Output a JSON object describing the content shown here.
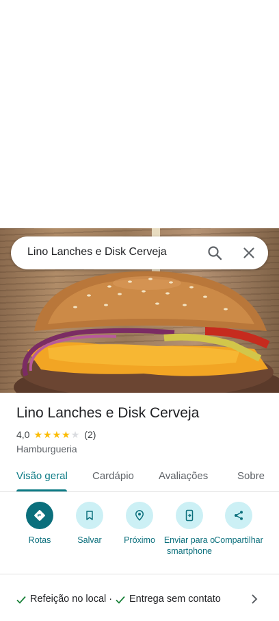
{
  "search": {
    "query": "Lino Lanches e Disk Cerveja"
  },
  "place": {
    "name": "Lino Lanches e Disk Cerveja",
    "rating": "4,0",
    "rating_value": 4,
    "rating_max": 5,
    "review_count": "(2)",
    "category": "Hamburgueria"
  },
  "tabs": [
    {
      "label": "Visão geral",
      "active": true
    },
    {
      "label": "Cardápio",
      "active": false
    },
    {
      "label": "Avaliações",
      "active": false
    },
    {
      "label": "Sobre",
      "active": false
    }
  ],
  "actions": [
    {
      "label": "Rotas",
      "icon": "directions-icon"
    },
    {
      "label": "Salvar",
      "icon": "bookmark-icon"
    },
    {
      "label": "Próximo",
      "icon": "nearby-icon"
    },
    {
      "label": "Enviar para o smartphone",
      "icon": "send-to-phone-icon"
    },
    {
      "label": "Compartilhar",
      "icon": "share-icon"
    }
  ],
  "services": {
    "item1": "Refeição no local ·",
    "item2": "Entrega sem contato"
  },
  "colors": {
    "accent": "#0b7a84",
    "action_primary": "#0b6f7c",
    "action_bg": "#ccf0f5",
    "star": "#fbbc04",
    "check": "#188038"
  }
}
